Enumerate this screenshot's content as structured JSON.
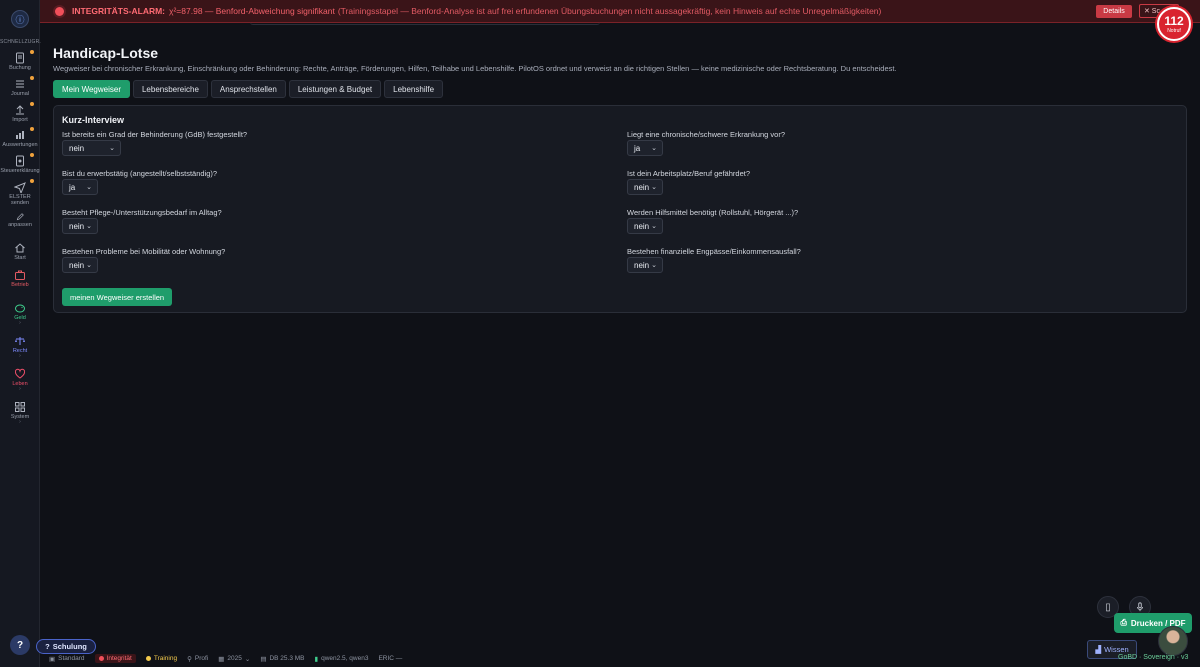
{
  "alarm": {
    "title": "INTEGRITÄTS-ALARM:",
    "text": "χ²=87.98 — Benford-Abweichung signifikant",
    "subtext": "(Trainingsstapel — Benford-Analyse ist auf frei erfundenen Übungsbuchungen nicht aussagekräftig, kein Hinweis auf echte Unregelmäßigkeiten)",
    "details_label": "Details",
    "close_label": "✕ Sc"
  },
  "notruf": {
    "number": "112",
    "label": "Notruf"
  },
  "sidebar": {
    "quick_label": "SCHNELLZUGR.",
    "items": [
      {
        "label": "Buchung"
      },
      {
        "label": "Journal"
      },
      {
        "label": "Import"
      },
      {
        "label": "Auswertungen"
      },
      {
        "label": "Steuererklärung"
      },
      {
        "label": "ELSTER senden"
      },
      {
        "label": "anpassen"
      },
      {
        "label": "Start"
      },
      {
        "label": "Betrieb"
      },
      {
        "label": "Geld",
        "sub": "›"
      },
      {
        "label": "Recht",
        "sub": "›"
      },
      {
        "label": "Leben",
        "sub": "›"
      },
      {
        "label": "System",
        "sub": "›"
      }
    ]
  },
  "page": {
    "title": "Handicap-Lotse",
    "subtitle": "Wegweiser bei chronischer Erkrankung, Einschränkung oder Behinderung: Rechte, Anträge, Förderungen, Hilfen, Teilhabe und Lebenshilfe. PilotOS ordnet und verweist an die richtigen Stellen — keine medizinische oder Rechtsberatung. Du entscheidest."
  },
  "tabs": [
    {
      "label": "Mein Wegweiser"
    },
    {
      "label": "Lebensbereiche"
    },
    {
      "label": "Ansprechstellen"
    },
    {
      "label": "Leistungen & Budget"
    },
    {
      "label": "Lebenshilfe"
    }
  ],
  "interview": {
    "title": "Kurz-Interview",
    "questions": [
      {
        "text": "Ist bereits ein Grad der Behinderung (GdB) festgestellt?",
        "value": "nein"
      },
      {
        "text": "Liegt eine chronische/schwere Erkrankung vor?",
        "value": "ja"
      },
      {
        "text": "Bist du erwerbstätig (angestellt/selbstständig)?",
        "value": "ja"
      },
      {
        "text": "Ist dein Arbeitsplatz/Beruf gefährdet?",
        "value": "nein"
      },
      {
        "text": "Besteht Pflege-/Unterstützungsbedarf im Alltag?",
        "value": "nein"
      },
      {
        "text": "Werden Hilfsmittel benötigt (Rollstuhl, Hörgerät ...)?",
        "value": "nein"
      },
      {
        "text": "Bestehen Probleme bei Mobilität oder Wohnung?",
        "value": "nein"
      },
      {
        "text": "Bestehen finanzielle Engpässe/Einkommensausfall?",
        "value": "nein"
      }
    ],
    "submit_label": "meinen Wegweiser erstellen"
  },
  "floating": {
    "print_label": "Drucken / PDF",
    "wissen_label": "Wissen",
    "gobd_label": "GoBD · Sovereign · v3"
  },
  "help": {
    "label": "?",
    "schulung_label": "Schulung"
  },
  "statusbar": {
    "standard": "Standard",
    "integritaet": "Integrität",
    "training": "Training",
    "profil": "Profi",
    "year": "2025",
    "db": "DB 25.3 MB",
    "models": "qwen2.5, qwen3",
    "eric": "ERIC —"
  },
  "colors": {
    "accent": "#1f9d6b",
    "alarm": "#f04f5a",
    "notruf": "#d9242f",
    "training": "#f2c94c"
  }
}
